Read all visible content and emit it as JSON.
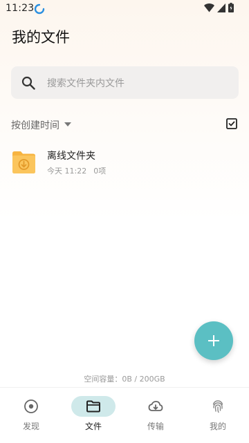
{
  "status_bar": {
    "time": "11:23",
    "icons": [
      "sync-icon",
      "wifi-icon",
      "signal-icon",
      "battery-icon"
    ]
  },
  "page": {
    "title": "我的文件"
  },
  "search": {
    "placeholder": "搜索文件夹内文件",
    "icon": "search-icon"
  },
  "sort": {
    "label": "按创建时间",
    "icon": "checkbox-select-icon"
  },
  "files": [
    {
      "name": "离线文件夹",
      "date": "今天 11:22",
      "count": "0项",
      "icon": "offline-folder-icon",
      "icon_color": "#f9c15a"
    }
  ],
  "fab": {
    "icon": "plus-icon",
    "color": "#5bbfc3"
  },
  "storage": {
    "text": "空间容量：0B / 200GB"
  },
  "nav": {
    "items": [
      {
        "label": "发现",
        "icon": "discover-icon"
      },
      {
        "label": "文件",
        "icon": "folder-icon",
        "active": true
      },
      {
        "label": "传输",
        "icon": "cloud-transfer-icon"
      },
      {
        "label": "我的",
        "icon": "fingerprint-icon"
      }
    ],
    "active_color": "#cfe9ea"
  }
}
